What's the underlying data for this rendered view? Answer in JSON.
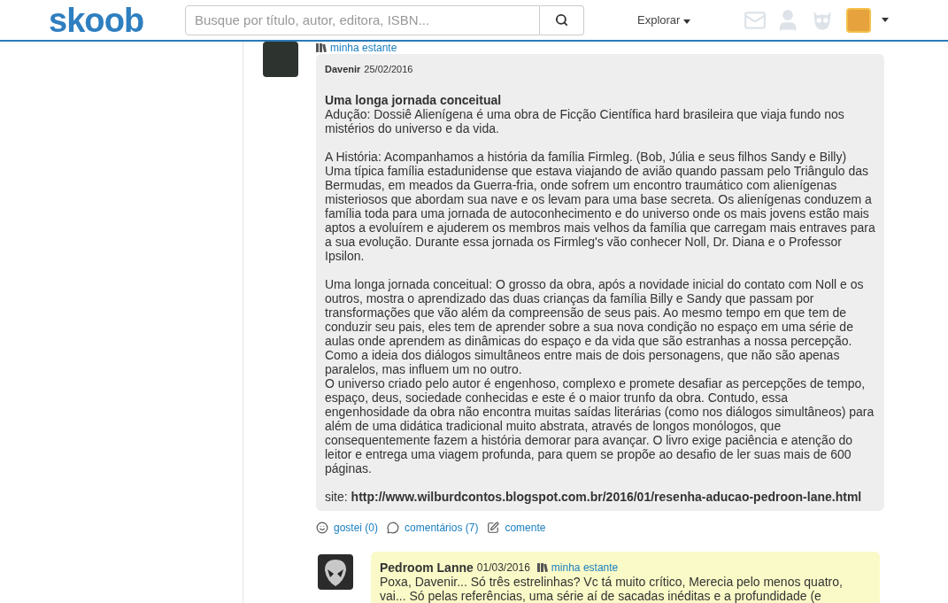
{
  "header": {
    "logo": "skoob",
    "search": {
      "placeholder": "Busque por título, autor, editora, ISBN..."
    },
    "explore": "Explorar"
  },
  "top_row": {
    "shelf_link": "minha estante"
  },
  "review": {
    "author": "Davenir",
    "date": "25/02/2016",
    "title": "Uma longa jornada conceitual",
    "sections": [
      [
        "Adução: Dossiê Alienígena é uma obra de Ficção Científica hard brasileira que viaja fundo nos mistérios do universo e da vida."
      ],
      [
        "A História: Acompanhamos a história da família Firmleg. (Bob, Júlia e seus filhos Sandy e Billy) Uma típica família estadunidense que estava viajando de avião quando passam pelo Triângulo das Bermudas, em meados da Guerra-fria, onde sofrem um encontro traumático com alienígenas misteriosos que abordam sua nave e os levam para uma base secreta. Os alienígenas conduzem a família toda para uma jornada de autoconhecimento e do universo onde os mais jovens estão mais aptos a evoluírem e ajuderem os membros mais velhos da família que carregam mais entraves para a sua evolução. Durante essa jornada os Firmleg's vão conhecer Noll, Dr. Diana e o Professor Ipsilon."
      ],
      [
        "Uma longa jornada conceitual: O grosso da obra, após a novidade inicial do contato com Noll e os outros, mostra o aprendizado das duas crianças da família Billy e Sandy que passam por transformações que vão além da compreensão de seus pais. Ao mesmo tempo em que tem de conduzir seu pais, eles tem de aprender sobre a sua nova condição no espaço em uma série de aulas onde aprendem as dinâmicas do espaço e da vida que são estranhas a nossa percepção. Como a ideia dos diálogos simultâneos entre mais de dois personagens, que não são apenas paralelos, mas influem um no outro.",
        "O universo criado pelo autor é engenhoso, complexo e promete desafiar as percepções de tempo, espaço, deus, sociedade conhecidas e este é o maior trunfo da obra. Contudo, essa engenhosidade da obra não encontra muitas saídas literárias (como nos diálogos simultâneos) para além de uma didática tradicional muito abstrata, através de longos monólogos, que consequentemente fazem a história demorar para avançar. O livro exige paciência e atenção do leitor e entrega uma viagem profunda, para quem se propõe ao desafio de ler suas mais de 600 páginas."
      ],
      [
        "site: **http://www.wilburdcontos.blogspot.com.br/2016/01/resenha-aducao-pedroon-lane.html**"
      ]
    ],
    "actions": [
      {
        "kind": "like",
        "label": "gostei (0)"
      },
      {
        "kind": "comments",
        "label": "comentários (7)"
      },
      {
        "kind": "comment",
        "label": "comente"
      }
    ]
  },
  "comment": {
    "author": "Pedroom Lanne",
    "date": "01/03/2016",
    "shelf_link": "minha estante",
    "text": "Poxa, Davenir... Só três estrelinhas? Vc tá muito crítico, Merecia pelo menos quatro, vai... Só pelas referências, uma série aí de sacadas inéditas e a profundidade (e"
  }
}
